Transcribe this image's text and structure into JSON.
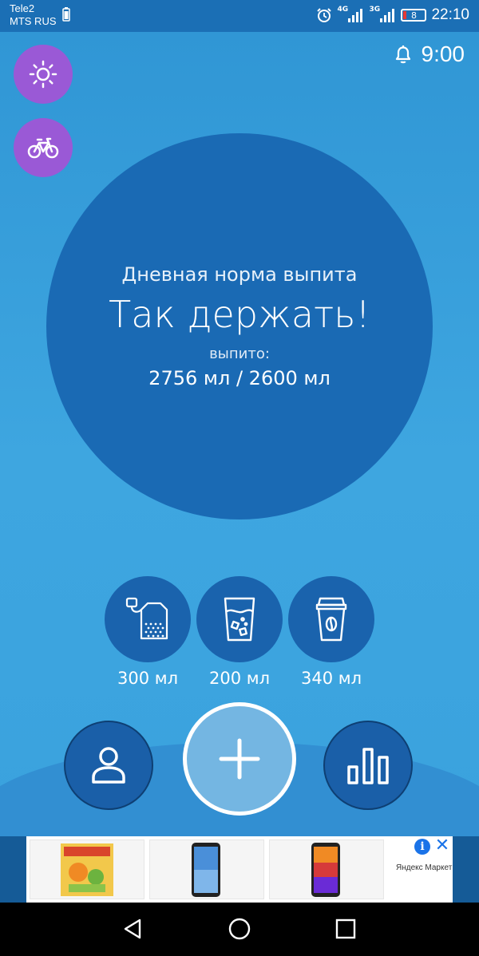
{
  "status_bar": {
    "carrier_1": "Tele2",
    "carrier_2": "MTS RUS",
    "network_1": "4G",
    "network_2": "3G",
    "battery_level": "8",
    "time": "22:10"
  },
  "header": {
    "reminder_time": "9:00"
  },
  "progress": {
    "line1": "Дневная норма выпита",
    "line2": "Так держать!",
    "line3": "выпито:",
    "line4": "2756 мл / 2600 мл"
  },
  "drinks": [
    {
      "icon": "tea-bag-icon",
      "amount": "300 мл"
    },
    {
      "icon": "water-glass-icon",
      "amount": "200 мл"
    },
    {
      "icon": "coffee-cup-icon",
      "amount": "340 мл"
    }
  ],
  "colors": {
    "background": "#3aa2de",
    "circle": "#1a6ab4",
    "accent_purple": "#9a59d6",
    "add_button": "#74b6e2"
  },
  "ad": {
    "brand": "Яндекс Маркет"
  }
}
